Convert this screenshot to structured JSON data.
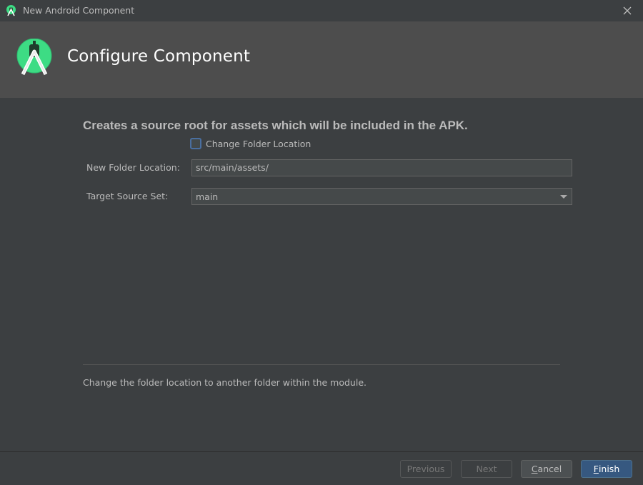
{
  "window": {
    "title": "New Android Component",
    "icon": "android-studio-icon",
    "close_icon": "close-icon"
  },
  "header": {
    "title": "Configure Component",
    "logo": "android-studio-logo"
  },
  "description": "Creates a source root for assets which will be included in the APK.",
  "change_folder": {
    "label": "Change Folder Location",
    "checked": false
  },
  "fields": {
    "folder_location": {
      "label": "New Folder Location:",
      "value": "src/main/assets/"
    },
    "target_source_set": {
      "label": "Target Source Set:",
      "value": "main"
    }
  },
  "help_text": "Change the folder location to another folder within the module.",
  "buttons": {
    "previous": "Previous",
    "next": "Next",
    "cancel_mnemonic": "C",
    "cancel_rest": "ancel",
    "finish_mnemonic": "F",
    "finish_rest": "inish"
  },
  "colors": {
    "background": "#3c3f41",
    "header": "#4d4d4d",
    "accent": "#365880",
    "android_green": "#3ddc84"
  }
}
